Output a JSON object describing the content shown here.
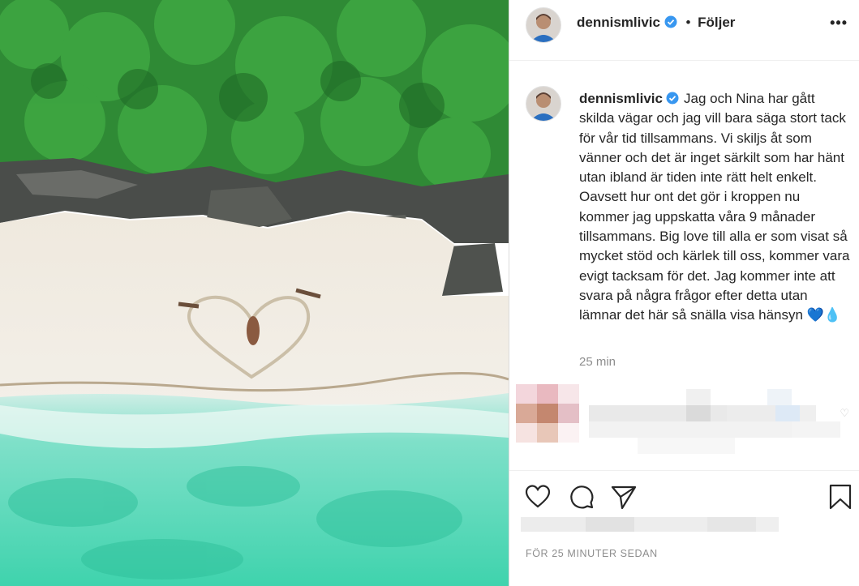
{
  "post": {
    "username": "dennismlivic",
    "follow_label": "Följer",
    "more_label": "•••",
    "caption": "Jag och Nina har gått skilda vägar och jag vill bara säga stort tack för vår tid tillsammans. Vi skiljs åt som vänner och det är inget särkilt som har hänt utan ibland är tiden inte rätt helt enkelt. Oavsett hur ont det gör i kroppen nu kommer jag uppskatta våra 9 månader tillsammans. Big love till alla er som visat så mycket stöd och kärlek till oss, kommer vara evigt tacksam för det. Jag kommer inte att svara på några frågor efter detta utan lämnar det här så snälla visa hänsyn 💙💧",
    "time": "25 min",
    "posted_ago": "FÖR 25 MINUTER SEDAN"
  },
  "icons": {
    "verified": "verified-badge-icon",
    "like": "heart-icon",
    "comment": "comment-icon",
    "share": "paper-plane-icon",
    "save": "bookmark-icon",
    "comment_like": "small-heart-icon"
  },
  "colors": {
    "verified_blue": "#3897f0",
    "text": "#262626",
    "muted": "#8e8e8e"
  }
}
